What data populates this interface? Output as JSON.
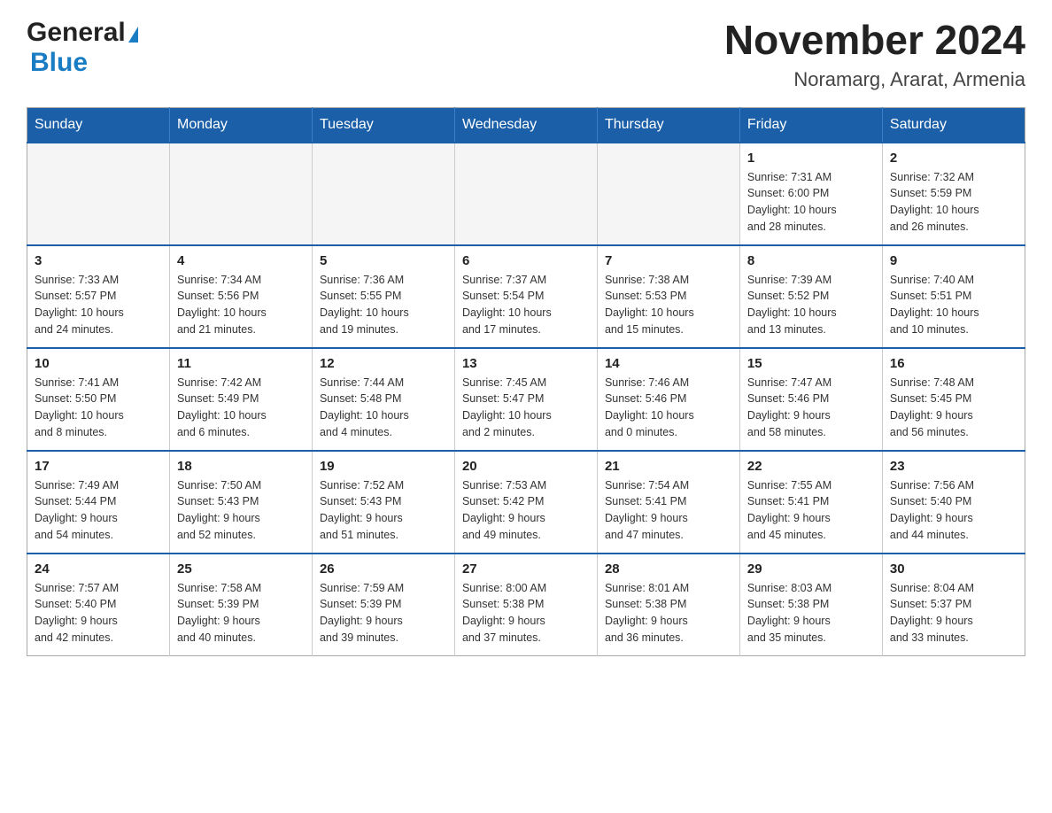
{
  "header": {
    "logo": {
      "general": "General",
      "triangle": "▶",
      "blue": "Blue"
    },
    "title": "November 2024",
    "subtitle": "Noramarg, Ararat, Armenia"
  },
  "calendar": {
    "days_of_week": [
      "Sunday",
      "Monday",
      "Tuesday",
      "Wednesday",
      "Thursday",
      "Friday",
      "Saturday"
    ],
    "weeks": [
      {
        "cells": [
          {
            "day": "",
            "info": "",
            "empty": true
          },
          {
            "day": "",
            "info": "",
            "empty": true
          },
          {
            "day": "",
            "info": "",
            "empty": true
          },
          {
            "day": "",
            "info": "",
            "empty": true
          },
          {
            "day": "",
            "info": "",
            "empty": true
          },
          {
            "day": "1",
            "info": "Sunrise: 7:31 AM\nSunset: 6:00 PM\nDaylight: 10 hours\nand 28 minutes."
          },
          {
            "day": "2",
            "info": "Sunrise: 7:32 AM\nSunset: 5:59 PM\nDaylight: 10 hours\nand 26 minutes."
          }
        ]
      },
      {
        "cells": [
          {
            "day": "3",
            "info": "Sunrise: 7:33 AM\nSunset: 5:57 PM\nDaylight: 10 hours\nand 24 minutes."
          },
          {
            "day": "4",
            "info": "Sunrise: 7:34 AM\nSunset: 5:56 PM\nDaylight: 10 hours\nand 21 minutes."
          },
          {
            "day": "5",
            "info": "Sunrise: 7:36 AM\nSunset: 5:55 PM\nDaylight: 10 hours\nand 19 minutes."
          },
          {
            "day": "6",
            "info": "Sunrise: 7:37 AM\nSunset: 5:54 PM\nDaylight: 10 hours\nand 17 minutes."
          },
          {
            "day": "7",
            "info": "Sunrise: 7:38 AM\nSunset: 5:53 PM\nDaylight: 10 hours\nand 15 minutes."
          },
          {
            "day": "8",
            "info": "Sunrise: 7:39 AM\nSunset: 5:52 PM\nDaylight: 10 hours\nand 13 minutes."
          },
          {
            "day": "9",
            "info": "Sunrise: 7:40 AM\nSunset: 5:51 PM\nDaylight: 10 hours\nand 10 minutes."
          }
        ]
      },
      {
        "cells": [
          {
            "day": "10",
            "info": "Sunrise: 7:41 AM\nSunset: 5:50 PM\nDaylight: 10 hours\nand 8 minutes."
          },
          {
            "day": "11",
            "info": "Sunrise: 7:42 AM\nSunset: 5:49 PM\nDaylight: 10 hours\nand 6 minutes."
          },
          {
            "day": "12",
            "info": "Sunrise: 7:44 AM\nSunset: 5:48 PM\nDaylight: 10 hours\nand 4 minutes."
          },
          {
            "day": "13",
            "info": "Sunrise: 7:45 AM\nSunset: 5:47 PM\nDaylight: 10 hours\nand 2 minutes."
          },
          {
            "day": "14",
            "info": "Sunrise: 7:46 AM\nSunset: 5:46 PM\nDaylight: 10 hours\nand 0 minutes."
          },
          {
            "day": "15",
            "info": "Sunrise: 7:47 AM\nSunset: 5:46 PM\nDaylight: 9 hours\nand 58 minutes."
          },
          {
            "day": "16",
            "info": "Sunrise: 7:48 AM\nSunset: 5:45 PM\nDaylight: 9 hours\nand 56 minutes."
          }
        ]
      },
      {
        "cells": [
          {
            "day": "17",
            "info": "Sunrise: 7:49 AM\nSunset: 5:44 PM\nDaylight: 9 hours\nand 54 minutes."
          },
          {
            "day": "18",
            "info": "Sunrise: 7:50 AM\nSunset: 5:43 PM\nDaylight: 9 hours\nand 52 minutes."
          },
          {
            "day": "19",
            "info": "Sunrise: 7:52 AM\nSunset: 5:43 PM\nDaylight: 9 hours\nand 51 minutes."
          },
          {
            "day": "20",
            "info": "Sunrise: 7:53 AM\nSunset: 5:42 PM\nDaylight: 9 hours\nand 49 minutes."
          },
          {
            "day": "21",
            "info": "Sunrise: 7:54 AM\nSunset: 5:41 PM\nDaylight: 9 hours\nand 47 minutes."
          },
          {
            "day": "22",
            "info": "Sunrise: 7:55 AM\nSunset: 5:41 PM\nDaylight: 9 hours\nand 45 minutes."
          },
          {
            "day": "23",
            "info": "Sunrise: 7:56 AM\nSunset: 5:40 PM\nDaylight: 9 hours\nand 44 minutes."
          }
        ]
      },
      {
        "cells": [
          {
            "day": "24",
            "info": "Sunrise: 7:57 AM\nSunset: 5:40 PM\nDaylight: 9 hours\nand 42 minutes."
          },
          {
            "day": "25",
            "info": "Sunrise: 7:58 AM\nSunset: 5:39 PM\nDaylight: 9 hours\nand 40 minutes."
          },
          {
            "day": "26",
            "info": "Sunrise: 7:59 AM\nSunset: 5:39 PM\nDaylight: 9 hours\nand 39 minutes."
          },
          {
            "day": "27",
            "info": "Sunrise: 8:00 AM\nSunset: 5:38 PM\nDaylight: 9 hours\nand 37 minutes."
          },
          {
            "day": "28",
            "info": "Sunrise: 8:01 AM\nSunset: 5:38 PM\nDaylight: 9 hours\nand 36 minutes."
          },
          {
            "day": "29",
            "info": "Sunrise: 8:03 AM\nSunset: 5:38 PM\nDaylight: 9 hours\nand 35 minutes."
          },
          {
            "day": "30",
            "info": "Sunrise: 8:04 AM\nSunset: 5:37 PM\nDaylight: 9 hours\nand 33 minutes."
          }
        ]
      }
    ]
  }
}
